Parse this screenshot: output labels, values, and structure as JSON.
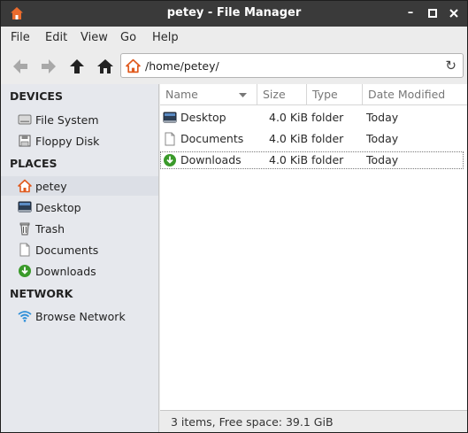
{
  "window": {
    "title": "petey - File Manager",
    "minimize": "–",
    "maximize": "□",
    "close": "✕"
  },
  "menu": [
    "File",
    "Edit",
    "View",
    "Go",
    "Help"
  ],
  "location": {
    "path": "/home/petey/"
  },
  "sidebar": {
    "devices_title": "DEVICES",
    "devices": [
      {
        "label": "File System",
        "icon": "drive-icon"
      },
      {
        "label": "Floppy Disk",
        "icon": "floppy-icon"
      }
    ],
    "places_title": "PLACES",
    "places": [
      {
        "label": "petey",
        "icon": "home-icon"
      },
      {
        "label": "Desktop",
        "icon": "desktop-icon"
      },
      {
        "label": "Trash",
        "icon": "trash-icon"
      },
      {
        "label": "Documents",
        "icon": "document-icon"
      },
      {
        "label": "Downloads",
        "icon": "download-icon"
      }
    ],
    "network_title": "NETWORK",
    "network": [
      {
        "label": "Browse Network",
        "icon": "wifi-icon"
      }
    ]
  },
  "columns": {
    "name": "Name",
    "size": "Size",
    "type": "Type",
    "date": "Date Modified"
  },
  "files": [
    {
      "name": "Desktop",
      "size": "4.0 KiB",
      "type": "folder",
      "date": "Today",
      "icon": "desktop-icon"
    },
    {
      "name": "Documents",
      "size": "4.0 KiB",
      "type": "folder",
      "date": "Today",
      "icon": "document-icon"
    },
    {
      "name": "Downloads",
      "size": "4.0 KiB",
      "type": "folder",
      "date": "Today",
      "icon": "download-icon"
    }
  ],
  "status": {
    "text": "3 items, Free space: 39.1 GiB"
  },
  "colors": {
    "titlebar": "#3a3a3a",
    "accent_home": "#e05a1e",
    "download_green": "#3a9a2a",
    "sidebar_bg": "#e6e8ed"
  }
}
